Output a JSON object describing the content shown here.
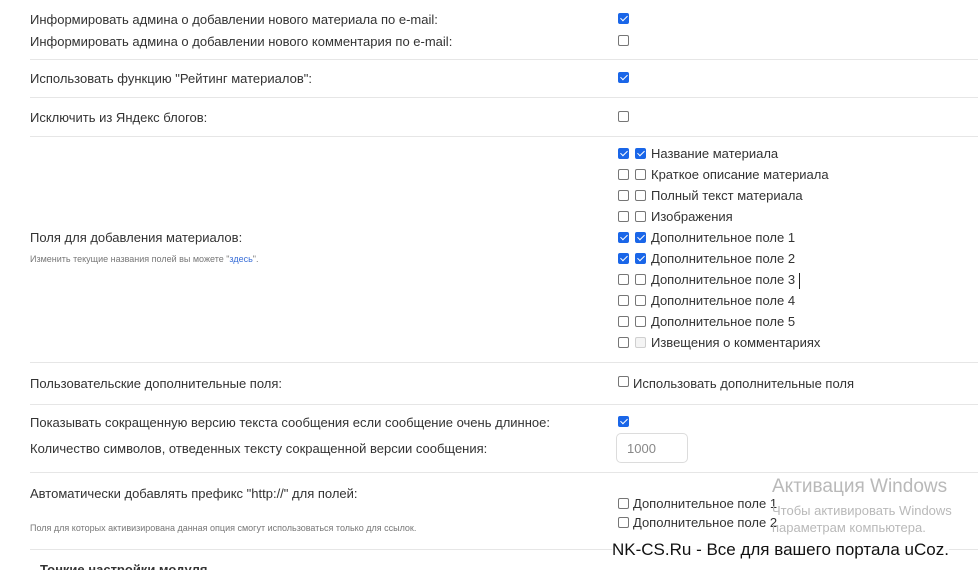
{
  "settings": {
    "notify_material": {
      "label": "Информировать админа о добавлении нового материала по e-mail:",
      "checked": true
    },
    "notify_comment": {
      "label": "Информировать админа о добавлении нового комментария по e-mail:",
      "checked": false
    },
    "rating": {
      "label": "Использовать функцию \"Рейтинг материалов\":",
      "checked": true
    },
    "exclude_yandex": {
      "label": "Исключить из Яндекс блогов:",
      "checked": false
    },
    "fields": {
      "label": "Поля для добавления материалов:",
      "hint_prefix": "Изменить текущие названия полей вы можете \"",
      "hint_link": "здесь",
      "hint_suffix": "\".",
      "items": [
        {
          "label": "Название материала",
          "c1": true,
          "c2": true
        },
        {
          "label": "Краткое описание материала",
          "c1": false,
          "c2": false
        },
        {
          "label": "Полный текст материала",
          "c1": false,
          "c2": false
        },
        {
          "label": "Изображения",
          "c1": false,
          "c2": false
        },
        {
          "label": "Дополнительное поле 1",
          "c1": true,
          "c2": true
        },
        {
          "label": "Дополнительное поле 2",
          "c1": true,
          "c2": true
        },
        {
          "label": "Дополнительное поле 3",
          "c1": false,
          "c2": false
        },
        {
          "label": "Дополнительное поле 4",
          "c1": false,
          "c2": false
        },
        {
          "label": "Дополнительное поле 5",
          "c1": false,
          "c2": false
        },
        {
          "label": "Извещения о комментариях",
          "c1": false,
          "c2": false
        }
      ]
    },
    "custom_fields": {
      "label": "Пользовательские дополнительные поля:",
      "option": "Использовать дополнительные поля",
      "checked": false
    },
    "short_version": {
      "label": "Показывать сокращенную версию текста сообщения если сообщение очень длинное:",
      "checked": true
    },
    "short_chars": {
      "label": "Количество символов, отведенных тексту сокращенной версии сообщения:",
      "value": "1000"
    },
    "http_prefix": {
      "label": "Автоматически добавлять префикс \"http://\" для полей:",
      "hint": "Поля для которых активизирована данная опция смогут использоваться только для ссылок.",
      "options": [
        {
          "label": "Дополнительное поле 1",
          "checked": false
        },
        {
          "label": "Дополнительное поле 2",
          "checked": false
        }
      ]
    },
    "next_section": "Тонкие настройки модуля"
  },
  "overlay": {
    "watermark_title": "Активация Windows",
    "watermark_line1": "Чтобы активировать Windows",
    "watermark_line2": "параметрам компьютера.",
    "site_banner": "NK-CS.Ru - Все для вашего портала uCoz."
  },
  "colors": {
    "checkbox_on": "#1a66e8",
    "link": "#3a6fd8",
    "divider": "#e6e6e6"
  }
}
